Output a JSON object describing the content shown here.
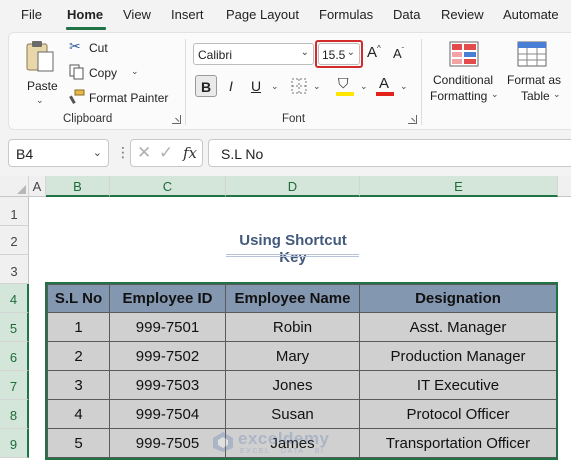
{
  "menu": {
    "tabs": [
      "File",
      "Home",
      "View",
      "Insert",
      "Page Layout",
      "Formulas",
      "Data",
      "Review",
      "Automate"
    ],
    "active": "Home"
  },
  "ribbon": {
    "clipboard": {
      "paste_label": "Paste",
      "cut_label": "Cut",
      "copy_label": "Copy",
      "format_painter_label": "Format Painter",
      "group_label": "Clipboard"
    },
    "font": {
      "font_name": "Calibri",
      "font_size": "15.5",
      "bold": "B",
      "italic": "I",
      "underline": "U",
      "group_label": "Font"
    },
    "styles": {
      "conditional_formatting_line1": "Conditional",
      "conditional_formatting_line2": "Formatting",
      "format_as_table_line1": "Format as",
      "format_as_table_line2": "Table"
    }
  },
  "formula_bar": {
    "name_box": "B4",
    "fx": "fx",
    "content": "S.L No"
  },
  "sheet": {
    "columns": [
      "A",
      "B",
      "C",
      "D",
      "E"
    ],
    "rows": [
      "1",
      "2",
      "3",
      "4",
      "5",
      "6",
      "7",
      "8",
      "9"
    ],
    "title": "Using Shortcut Key",
    "table": {
      "headers": [
        "S.L No",
        "Employee ID",
        "Employee Name",
        "Designation"
      ],
      "rows": [
        [
          "1",
          "999-7501",
          "Robin",
          "Asst. Manager"
        ],
        [
          "2",
          "999-7502",
          "Mary",
          "Production Manager"
        ],
        [
          "3",
          "999-7503",
          "Jones",
          "IT Executive"
        ],
        [
          "4",
          "999-7504",
          "Susan",
          "Protocol Officer"
        ],
        [
          "5",
          "999-7505",
          "James",
          "Transportation Officer"
        ]
      ]
    }
  },
  "watermark": {
    "name": "exceldemy",
    "tagline": "EXCEL · DATA · BI"
  },
  "colors": {
    "accent": "#217346",
    "header_fill": "#8497b0",
    "body_fill": "#d0d0d0",
    "title_color": "#445a7c",
    "highlight_red": "#d22b2b"
  }
}
